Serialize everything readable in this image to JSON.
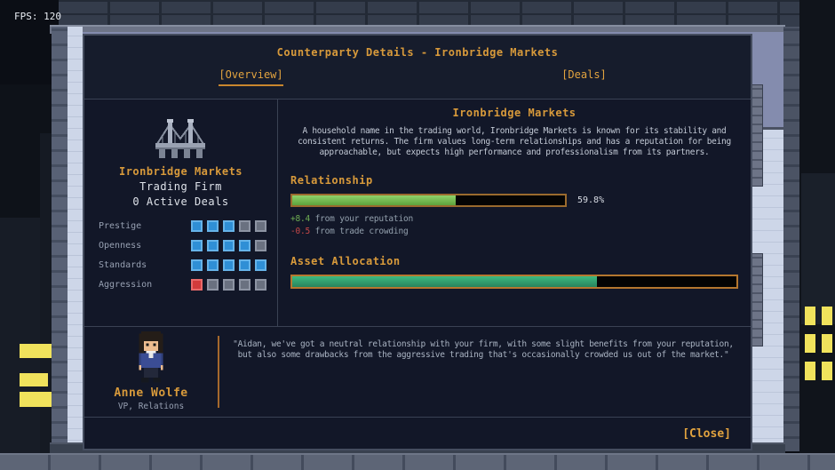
{
  "hud": {
    "fps": "FPS: 120"
  },
  "modal": {
    "title": "Counterparty Details - Ironbridge Markets",
    "tabs": [
      {
        "label": "[Overview]",
        "active": true
      },
      {
        "label": "[Deals]",
        "active": false
      }
    ],
    "close_label": "[Close]"
  },
  "firm": {
    "name": "Ironbridge Markets",
    "type": "Trading Firm",
    "active_deals": "0 Active Deals",
    "stats": [
      {
        "label": "Prestige",
        "value": 3,
        "max": 5,
        "color": "blue"
      },
      {
        "label": "Openness",
        "value": 4,
        "max": 5,
        "color": "blue"
      },
      {
        "label": "Standards",
        "value": 5,
        "max": 5,
        "color": "blue"
      },
      {
        "label": "Aggression",
        "value": 1,
        "max": 5,
        "color": "red"
      }
    ]
  },
  "overview": {
    "heading": "Ironbridge Markets",
    "description": "A household name in the trading world, Ironbridge Markets is known for its stability and consistent returns. The firm values long-term relationships and has a reputation for being approachable, but expects high performance and professionalism from its partners.",
    "relationship": {
      "heading": "Relationship",
      "percent": 59.8,
      "percent_label": "59.8%",
      "modifiers": [
        {
          "value": "+8.4",
          "text": "from your reputation",
          "type": "positive"
        },
        {
          "value": "-0.5",
          "text": "from trade crowding",
          "type": "negative"
        }
      ]
    },
    "asset_allocation": {
      "heading": "Asset Allocation",
      "percent": 68.5
    }
  },
  "advisor": {
    "name": "Anne Wolfe",
    "title": "VP, Relations",
    "quote": "\"Aidan, we've got a neutral relationship with your firm, with some slight benefits from your reputation, but also some drawbacks from the aggressive trading that's occasionally crowded us out of the market.\""
  },
  "colors": {
    "accent_orange": "#d89a3b",
    "relationship_fill": "#76c44f",
    "asset_fill": "#31a371",
    "stat_blue": "#2f8fd6",
    "stat_red": "#d23b3b",
    "stat_gray": "#6a7180",
    "positive_green": "#6fae52",
    "negative_red": "#c84848",
    "window_yellow": "#f0e25c"
  }
}
